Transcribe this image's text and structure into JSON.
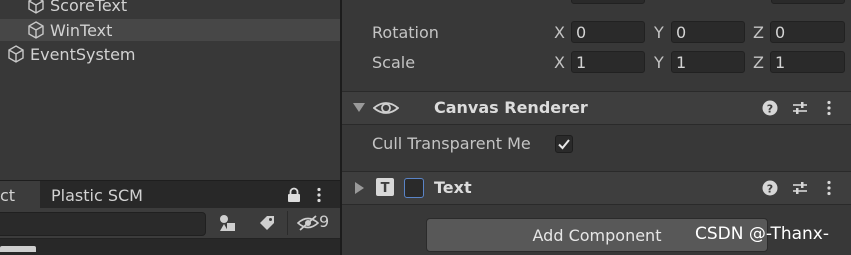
{
  "hierarchy": {
    "items": [
      {
        "label": "ScoreText"
      },
      {
        "label": "WinText"
      },
      {
        "label": "EventSystem"
      }
    ]
  },
  "bottom_panel": {
    "tabs": [
      {
        "label": "ct"
      },
      {
        "label": "Plastic SCM"
      }
    ],
    "hidden_count": "9"
  },
  "inspector": {
    "rotation": {
      "label": "Rotation",
      "x_axis": "X",
      "y_axis": "Y",
      "z_axis": "Z",
      "x": "0",
      "y": "0",
      "z": "0"
    },
    "scale": {
      "label": "Scale",
      "x_axis": "X",
      "y_axis": "Y",
      "z_axis": "Z",
      "x": "1",
      "y": "1",
      "z": "1"
    },
    "canvas_renderer": {
      "title": "Canvas Renderer",
      "cull_label": "Cull Transparent Me",
      "cull_checked": true
    },
    "text_component": {
      "title": "Text",
      "enabled": false,
      "icon_letter": "T"
    },
    "add_component_label": "Add Component"
  },
  "watermark": "CSDN @-Thanx-"
}
